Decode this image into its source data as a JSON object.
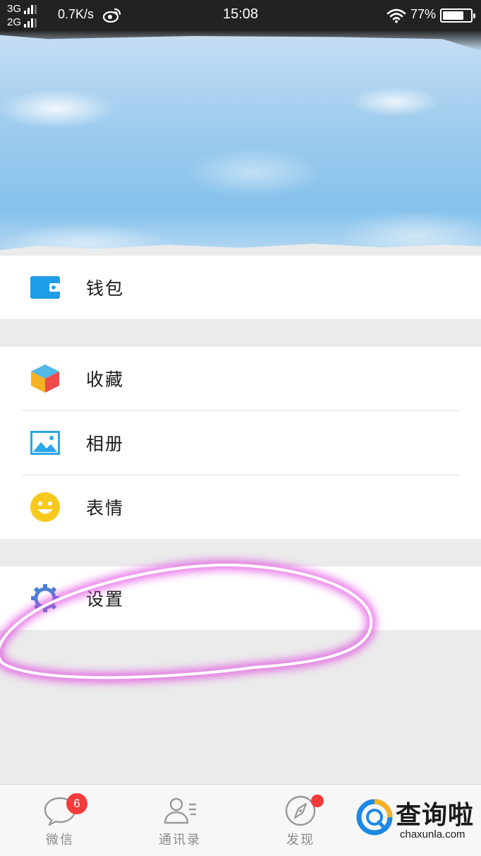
{
  "status_bar": {
    "network_top": "3G",
    "network_bottom": "2G",
    "speed": "0.7K/s",
    "time": "15:08",
    "battery_text": "77%",
    "battery_level": 0.77
  },
  "menu": {
    "wallet": {
      "label": "钱包",
      "icon": "wallet-icon"
    },
    "favorites": {
      "label": "收藏",
      "icon": "cube-icon"
    },
    "album": {
      "label": "相册",
      "icon": "picture-icon"
    },
    "stickers": {
      "label": "表情",
      "icon": "smiley-icon"
    },
    "settings": {
      "label": "设置",
      "icon": "gear-icon"
    }
  },
  "tab_bar": {
    "chats": {
      "label": "微信",
      "badge": "6",
      "icon": "chat-bubble-icon"
    },
    "contacts": {
      "label": "通讯录",
      "icon": "contacts-icon"
    },
    "discover": {
      "label": "发现",
      "icon": "compass-icon"
    }
  },
  "watermark": {
    "title": "查询啦",
    "url": "chaxunla.com"
  },
  "colors": {
    "status_bar_bg": "#222222",
    "page_bg": "#ebebeb",
    "wallet_blue": "#1e9de8",
    "album_blue": "#2ba6e8",
    "smiley_yellow": "#f7c91c",
    "gear_blue": "#4a7fd6",
    "badge_red": "#f43b3b",
    "annotation_magenta": "#e040e0"
  }
}
